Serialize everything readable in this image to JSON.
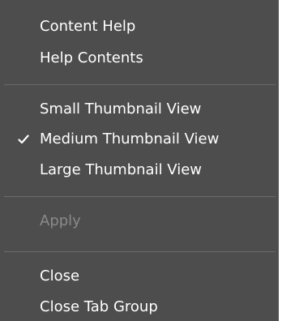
{
  "menu": {
    "groups": [
      {
        "items": [
          {
            "label": "Content Help"
          },
          {
            "label": "Help Contents"
          }
        ]
      },
      {
        "items": [
          {
            "label": "Small Thumbnail View"
          },
          {
            "label": "Medium Thumbnail View",
            "checked": true
          },
          {
            "label": "Large Thumbnail View"
          }
        ]
      },
      {
        "items": [
          {
            "label": "Apply",
            "disabled": true
          }
        ]
      },
      {
        "items": [
          {
            "label": "Close"
          },
          {
            "label": "Close Tab Group"
          }
        ]
      }
    ]
  },
  "colors": {
    "menu_background": "#4d4d4d",
    "text": "#ffffff",
    "disabled_text": "#8a8a8a",
    "separator": "#6a6a6a"
  },
  "icons": {
    "checked_item": "checkmark-icon"
  }
}
